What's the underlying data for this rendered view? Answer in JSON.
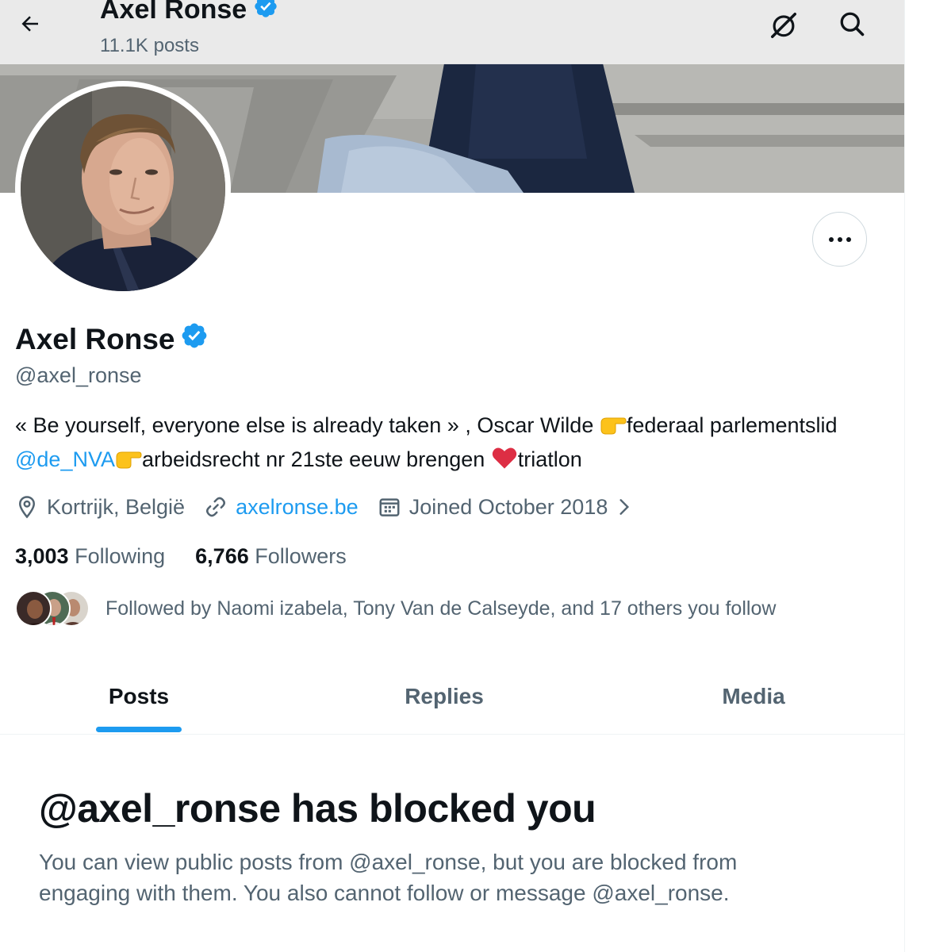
{
  "header": {
    "name": "Axel Ronse",
    "posts_count": "11.1K posts"
  },
  "profile": {
    "display_name": "Axel Ronse",
    "handle": "@axel_ronse",
    "bio": {
      "part1": "« Be yourself, everyone else is already taken » , Oscar Wilde ",
      "part2": "federaal parlementslid ",
      "mention": "@de_NVA",
      "part3": "arbeidsrecht nr 21ste eeuw brengen ",
      "part4": "triatlon"
    },
    "location": "Kortrijk, België",
    "website": "axelronse.be",
    "joined": "Joined October 2018",
    "following_count": "3,003",
    "following_label": "Following",
    "followers_count": "6,766",
    "followers_label": "Followers",
    "followed_by": "Followed by Naomi izabela, Tony Van de Calseyde, and 17 others you follow"
  },
  "tabs": [
    {
      "label": "Posts",
      "active": true
    },
    {
      "label": "Replies",
      "active": false
    },
    {
      "label": "Media",
      "active": false
    }
  ],
  "blocked": {
    "title": "@axel_ronse has blocked you",
    "description": "You can view public posts from @axel_ronse, but you are blocked from engaging with them. You also cannot follow or message @axel_ronse."
  },
  "icons": {
    "back": "arrow-left-icon",
    "grok": "grok-icon",
    "search": "search-icon",
    "more": "more-dots-icon",
    "verified": "verified-badge-icon",
    "location": "location-pin-icon",
    "link": "link-icon",
    "calendar": "calendar-icon",
    "pointing": "pointing-hand-emoji",
    "heart": "red-heart-emoji"
  },
  "colors": {
    "accent": "#1d9bf0",
    "text_primary": "#0f1419",
    "text_secondary": "#536471"
  }
}
